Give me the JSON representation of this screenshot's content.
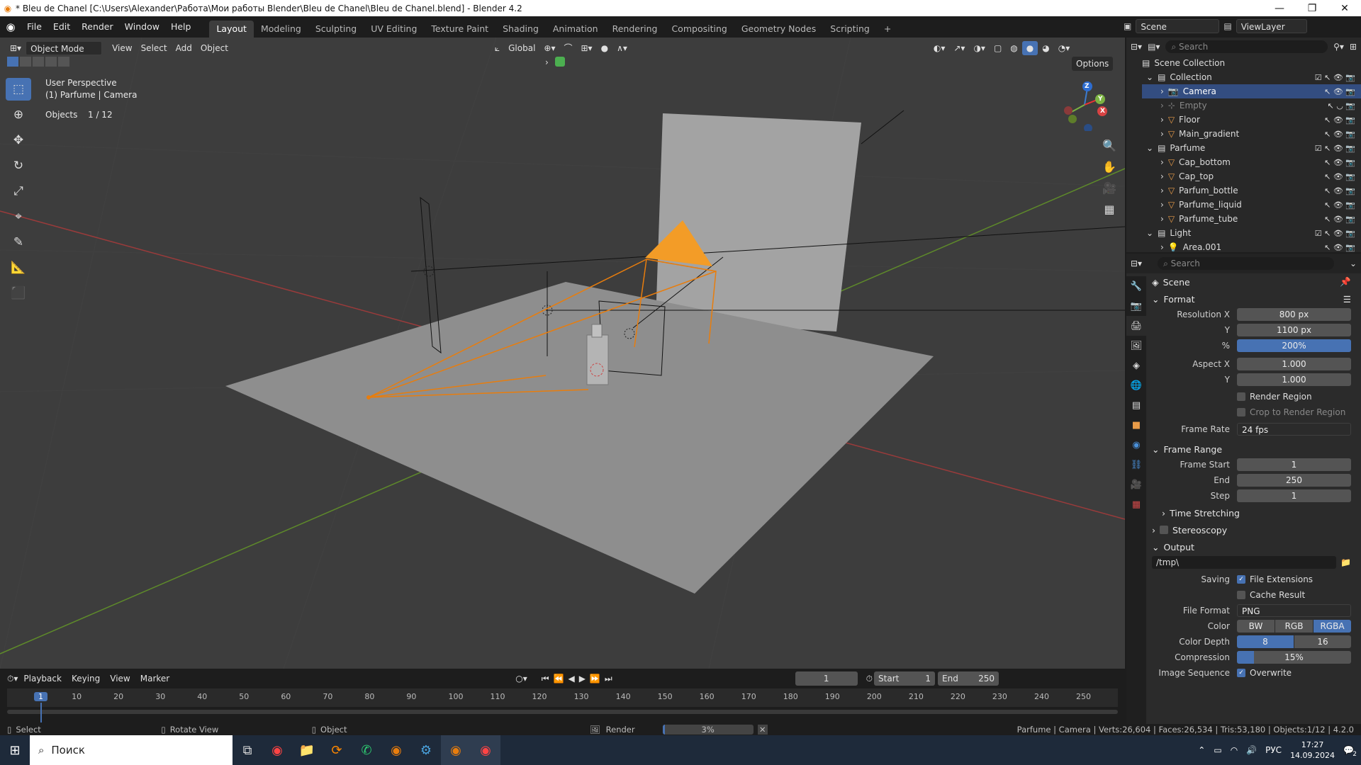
{
  "window": {
    "title": "* Bleu de Chanel [C:\\Users\\Alexander\\Работа\\Мои работы Blender\\Bleu de Chanel\\Bleu de Chanel.blend] - Blender 4.2",
    "minimize": "—",
    "maximize": "❐",
    "close": "✕"
  },
  "menu": [
    "File",
    "Edit",
    "Render",
    "Window",
    "Help"
  ],
  "workspaces": [
    "Layout",
    "Modeling",
    "Sculpting",
    "UV Editing",
    "Texture Paint",
    "Shading",
    "Animation",
    "Rendering",
    "Compositing",
    "Geometry Nodes",
    "Scripting"
  ],
  "scene_selector": {
    "scene": "Scene",
    "view_layer": "ViewLayer"
  },
  "viewport_header": {
    "mode": "Object Mode",
    "menus": [
      "View",
      "Select",
      "Add",
      "Object"
    ],
    "transform_orientation": "Global",
    "options": "Options"
  },
  "viewport_overlay": {
    "perspective": "User Perspective",
    "context": "(1) Parfume | Camera",
    "objects_label": "Objects",
    "objects_count": "1 / 12"
  },
  "gizmo_axes": {
    "x": "X",
    "y": "Y",
    "z": "Z"
  },
  "outliner": {
    "search_placeholder": "Search",
    "scene_collection": "Scene Collection",
    "collections": [
      {
        "name": "Collection",
        "items": [
          "Camera",
          "Empty",
          "Floor",
          "Main_gradient"
        ]
      },
      {
        "name": "Parfume",
        "items": [
          "Cap_bottom",
          "Cap_top",
          "Parfum_bottle",
          "Parfume_liquid",
          "Parfume_tube"
        ]
      },
      {
        "name": "Light",
        "items": [
          "Area.001"
        ]
      }
    ]
  },
  "properties": {
    "search_placeholder": "Search",
    "context": "Scene",
    "format": {
      "title": "Format",
      "resolution_x_label": "Resolution X",
      "resolution_x": "800 px",
      "y_label": "Y",
      "resolution_y": "1100 px",
      "pct_label": "%",
      "resolution_pct": "200%",
      "aspect_x_label": "Aspect X",
      "aspect_x": "1.000",
      "aspect_y_label": "Y",
      "aspect_y": "1.000",
      "render_region": "Render Region",
      "crop": "Crop to Render Region",
      "frame_rate_label": "Frame Rate",
      "frame_rate": "24 fps"
    },
    "frame_range": {
      "title": "Frame Range",
      "start_label": "Frame Start",
      "start": "1",
      "end_label": "End",
      "end": "250",
      "step_label": "Step",
      "step": "1"
    },
    "time_stretching": "Time Stretching",
    "stereoscopy": "Stereoscopy",
    "output": {
      "title": "Output",
      "path": "/tmp\\",
      "saving_label": "Saving",
      "file_extensions": "File Extensions",
      "cache_result": "Cache Result",
      "file_format_label": "File Format",
      "file_format": "PNG",
      "color_label": "Color",
      "color_options": [
        "BW",
        "RGB",
        "RGBA"
      ],
      "color_depth_label": "Color Depth",
      "color_depth_options": [
        "8",
        "16"
      ],
      "compression_label": "Compression",
      "compression": "15%",
      "compression_fraction": 0.15,
      "image_sequence_label": "Image Sequence",
      "overwrite": "Overwrite"
    }
  },
  "timeline": {
    "menus": [
      "Playback",
      "Keying",
      "View",
      "Marker"
    ],
    "current_frame": "1",
    "start_label": "Start",
    "start": "1",
    "end_label": "End",
    "end": "250",
    "ruler": [
      "1",
      "10",
      "20",
      "30",
      "40",
      "50",
      "60",
      "70",
      "80",
      "90",
      "100",
      "110",
      "120",
      "130",
      "140",
      "150",
      "160",
      "170",
      "180",
      "190",
      "200",
      "210",
      "220",
      "230",
      "240",
      "250"
    ]
  },
  "statusbar": {
    "select": "Select",
    "rotate": "Rotate View",
    "object": "Object",
    "render_label": "Render",
    "render_progress": "3%",
    "render_fraction": 0.03,
    "stats": "Parfume | Camera | Verts:26,604 | Faces:26,534 | Tris:53,180 | Objects:1/12 | 4.2.0"
  },
  "taskbar": {
    "search": "Поиск",
    "lang": "РУС",
    "time": "17:27",
    "date": "14.09.2024",
    "notification_count": "2"
  },
  "colors": {
    "accent": "#4772b3",
    "selection": "#e87d0d",
    "viewport_bg": "#3d3d3d"
  }
}
